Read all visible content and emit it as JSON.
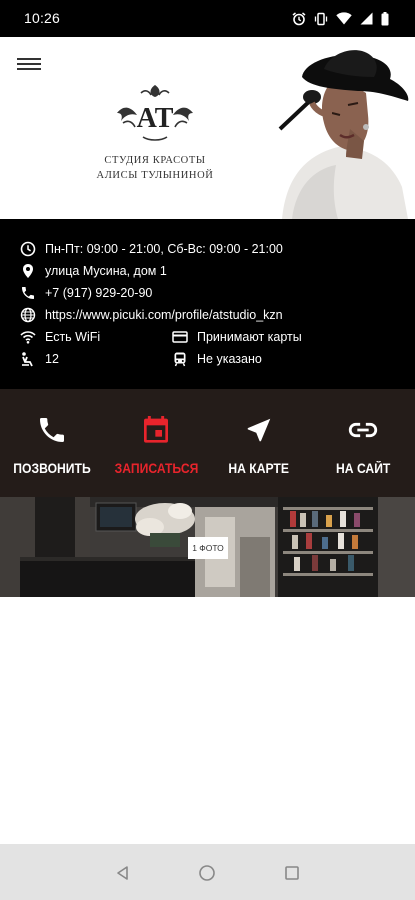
{
  "status_bar": {
    "time": "10:26"
  },
  "header": {
    "logo_initials": "AT",
    "logo_line1": "СТУДИЯ КРАСОТЫ",
    "logo_line2": "АЛИСЫ ТУЛЫНИНОЙ"
  },
  "info": {
    "hours": "Пн-Пт: 09:00 - 21:00, Сб-Вс: 09:00 - 21:00",
    "address": "улица Мусина, дом 1",
    "phone": "+7 (917) 929-20-90",
    "website": "https://www.picuki.com/profile/atstudio_kzn",
    "wifi": "Есть WiFi",
    "cards": "Принимают карты",
    "seats": "12",
    "transport": "Не указано"
  },
  "actions": [
    {
      "label": "ПОЗВОНИТЬ",
      "icon": "phone-icon",
      "active": false
    },
    {
      "label": "ЗАПИСАТЬСЯ",
      "icon": "calendar-icon",
      "active": true
    },
    {
      "label": "НА КАРТЕ",
      "icon": "navigation-icon",
      "active": false
    },
    {
      "label": "НА САЙТ",
      "icon": "link-icon",
      "active": false
    }
  ],
  "gallery": {
    "badge": "1 ФОТО"
  },
  "colors": {
    "accent": "#e8242c",
    "info_background": "#000000",
    "actions_background": "#241c19",
    "nav_background": "#e3e3e3"
  }
}
